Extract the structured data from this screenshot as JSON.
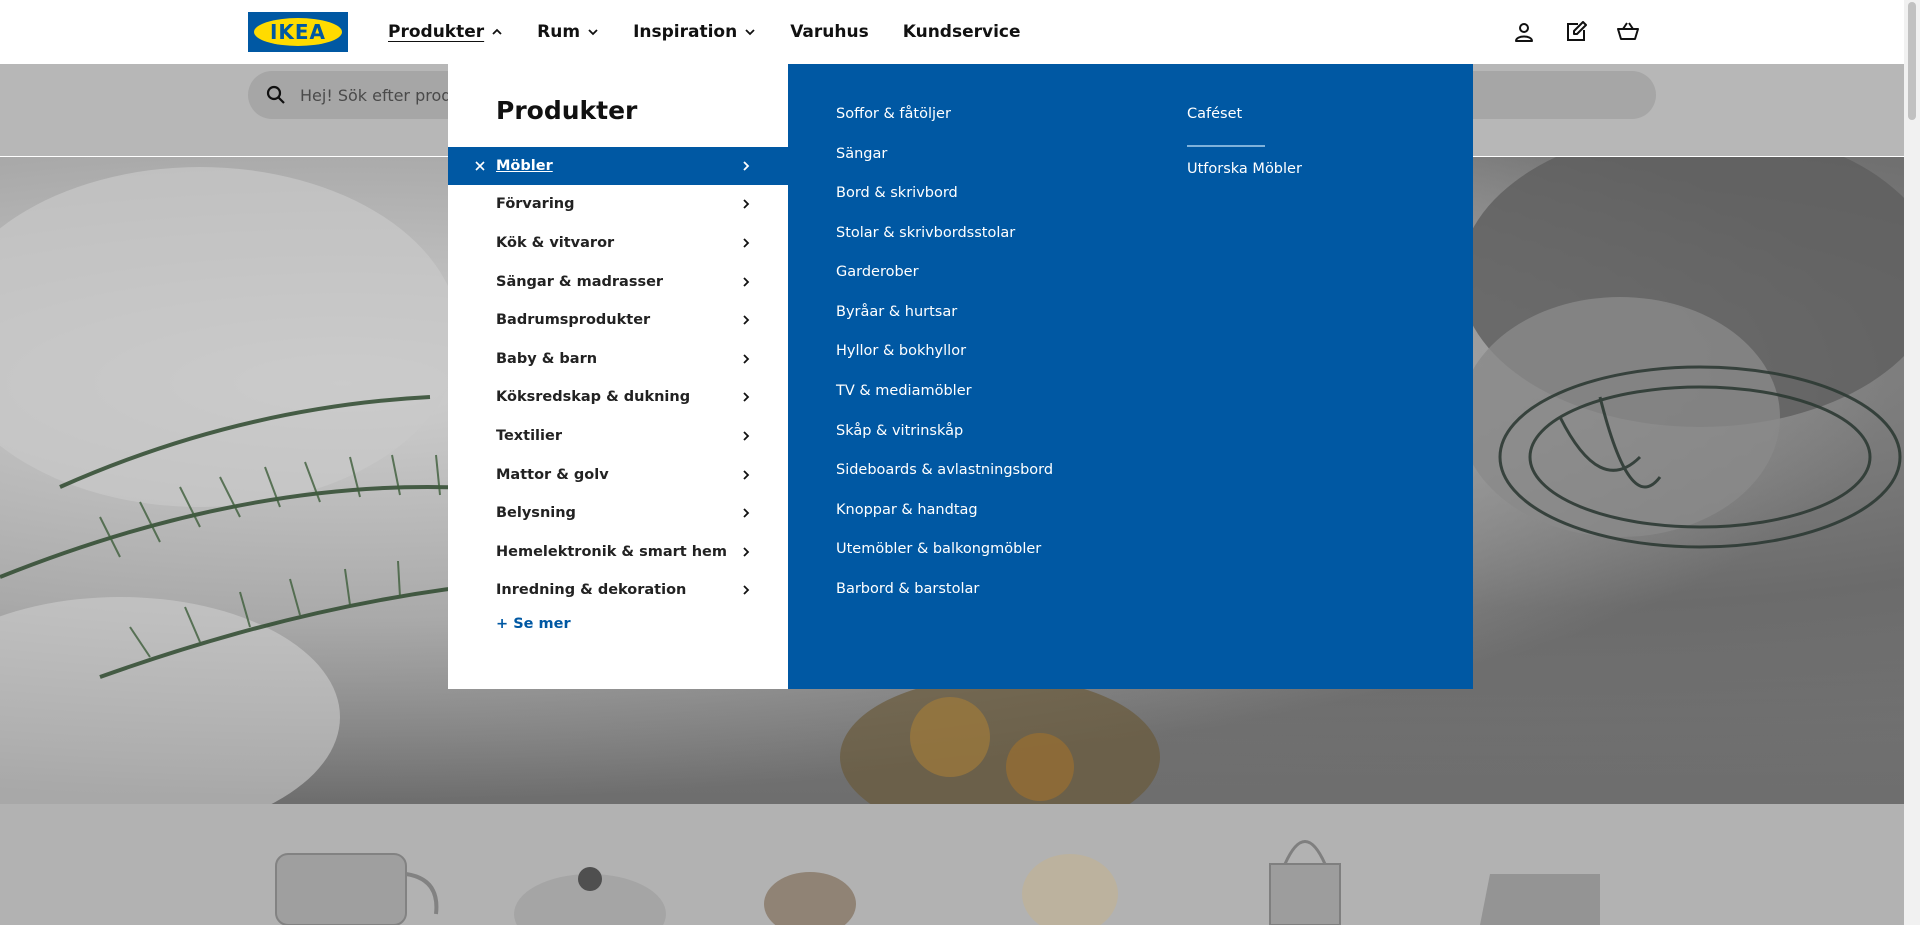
{
  "header": {
    "logo_text": "IKEA",
    "nav": [
      {
        "label": "Produkter",
        "has_chevron": true,
        "expanded": true
      },
      {
        "label": "Rum",
        "has_chevron": true,
        "expanded": false
      },
      {
        "label": "Inspiration",
        "has_chevron": true,
        "expanded": false
      },
      {
        "label": "Varuhus",
        "has_chevron": false,
        "expanded": false
      },
      {
        "label": "Kundservice",
        "has_chevron": false,
        "expanded": false
      }
    ],
    "icons": [
      "user-icon",
      "shopping-list-icon",
      "cart-icon"
    ]
  },
  "search": {
    "placeholder": "Hej! Sök efter produ"
  },
  "menu": {
    "title": "Produkter",
    "categories": [
      {
        "label": "Möbler",
        "selected": true
      },
      {
        "label": "Förvaring",
        "selected": false
      },
      {
        "label": "Kök & vitvaror",
        "selected": false
      },
      {
        "label": "Sängar & madrasser",
        "selected": false
      },
      {
        "label": "Badrumsprodukter",
        "selected": false
      },
      {
        "label": "Baby & barn",
        "selected": false
      },
      {
        "label": "Köksredskap & dukning",
        "selected": false
      },
      {
        "label": "Textilier",
        "selected": false
      },
      {
        "label": "Mattor & golv",
        "selected": false
      },
      {
        "label": "Belysning",
        "selected": false
      },
      {
        "label": "Hemelektronik & smart hem",
        "selected": false
      },
      {
        "label": "Inredning & dekoration",
        "selected": false
      }
    ],
    "see_more": "+ Se mer",
    "subcategories": [
      "Soffor & fåtöljer",
      "Sängar",
      "Bord & skrivbord",
      "Stolar & skrivbordsstolar",
      "Garderober",
      "Byråar & hurtsar",
      "Hyllor & bokhyllor",
      "TV & mediamöbler",
      "Skåp & vitrinskåp",
      "Sideboards & avlastningsbord",
      "Knoppar & handtag",
      "Utemöbler & balkongmöbler",
      "Barbord & barstolar"
    ],
    "side_links": {
      "top": "Caféset",
      "explore": "Utforska Möbler"
    }
  },
  "colors": {
    "brand_blue": "#0058a3",
    "brand_yellow": "#ffdb00"
  }
}
